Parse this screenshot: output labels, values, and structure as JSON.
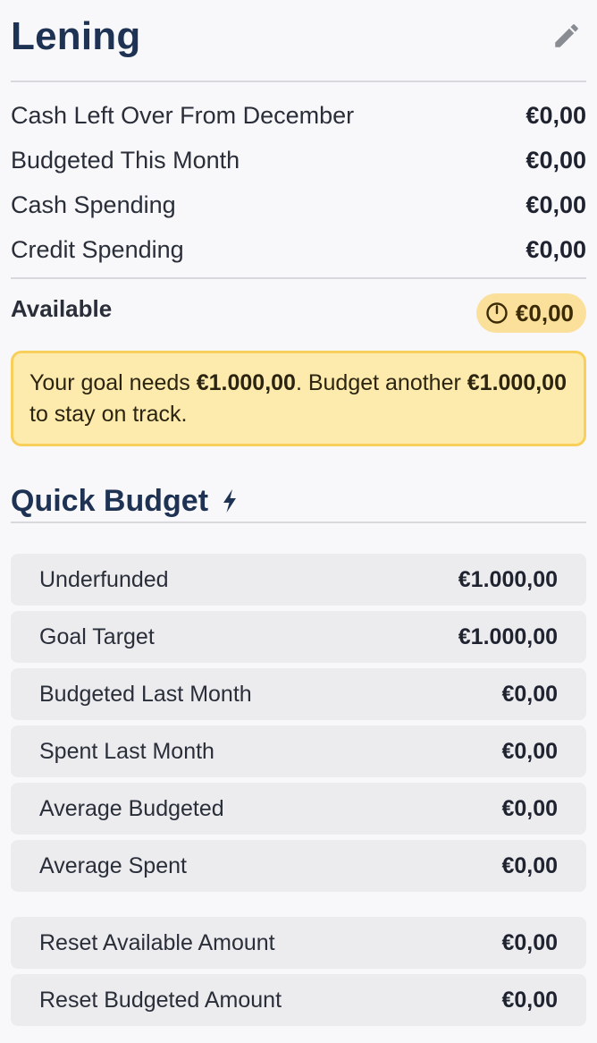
{
  "category": {
    "title": "Lening",
    "edit_icon": "pencil-icon"
  },
  "summary": {
    "rows": [
      {
        "label": "Cash Left Over From December",
        "value": "€0,00"
      },
      {
        "label": "Budgeted This Month",
        "value": "€0,00"
      },
      {
        "label": "Cash Spending",
        "value": "€0,00"
      },
      {
        "label": "Credit Spending",
        "value": "€0,00"
      }
    ],
    "available_label": "Available",
    "available_value": "€0,00",
    "available_icon": "clock-icon"
  },
  "goal_message": {
    "prefix": "Your goal needs ",
    "amount1": "€1.000,00",
    "middle": ". Budget another ",
    "amount2": "€1.000,00",
    "suffix": " to stay on track."
  },
  "quick_budget": {
    "title": "Quick Budget",
    "icon": "lightning-icon",
    "items": [
      {
        "label": "Underfunded",
        "value": "€1.000,00"
      },
      {
        "label": "Goal Target",
        "value": "€1.000,00"
      },
      {
        "label": "Budgeted Last Month",
        "value": "€0,00"
      },
      {
        "label": "Spent Last Month",
        "value": "€0,00"
      },
      {
        "label": "Average Budgeted",
        "value": "€0,00"
      },
      {
        "label": "Average Spent",
        "value": "€0,00"
      }
    ],
    "reset_items": [
      {
        "label": "Reset Available Amount",
        "value": "€0,00"
      },
      {
        "label": "Reset Budgeted Amount",
        "value": "€0,00"
      }
    ]
  },
  "colors": {
    "title": "#1e3254",
    "pill_bg": "#fbe09b",
    "goal_bg": "#fdeaad",
    "goal_border": "#f7cf5a",
    "item_bg": "#ececef"
  }
}
